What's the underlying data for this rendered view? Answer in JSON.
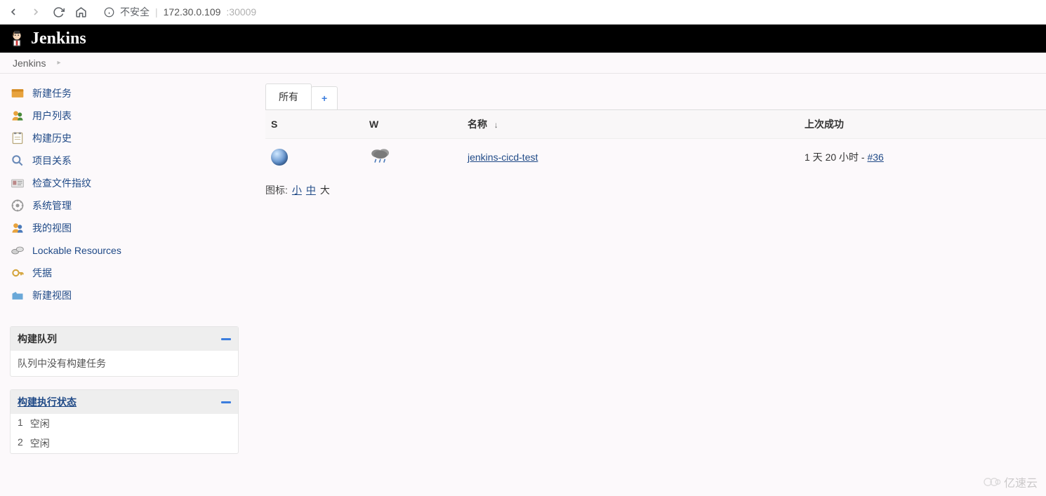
{
  "browser": {
    "insecure_label": "不安全",
    "url_host": "172.30.0.109",
    "url_port": ":30009"
  },
  "header": {
    "app_name": "Jenkins"
  },
  "breadcrumb": {
    "root": "Jenkins"
  },
  "sidebar": {
    "items": [
      {
        "label": "新建任务",
        "icon": "new-item-icon"
      },
      {
        "label": "用户列表",
        "icon": "people-icon"
      },
      {
        "label": "构建历史",
        "icon": "history-icon"
      },
      {
        "label": "项目关系",
        "icon": "relations-icon"
      },
      {
        "label": "检查文件指纹",
        "icon": "fingerprint-icon"
      },
      {
        "label": "系统管理",
        "icon": "manage-icon"
      },
      {
        "label": "我的视图",
        "icon": "my-views-icon"
      },
      {
        "label": "Lockable Resources",
        "icon": "lockable-icon"
      },
      {
        "label": "凭据",
        "icon": "credentials-icon"
      },
      {
        "label": "新建视图",
        "icon": "new-view-icon"
      }
    ]
  },
  "queue": {
    "title": "构建队列",
    "empty_text": "队列中没有构建任务"
  },
  "executors": {
    "title": "构建执行状态",
    "rows": [
      {
        "num": "1",
        "status": "空闲"
      },
      {
        "num": "2",
        "status": "空闲"
      }
    ]
  },
  "tabs": {
    "all": "所有",
    "add": "+"
  },
  "table": {
    "headers": {
      "s": "S",
      "w": "W",
      "name": "名称",
      "sort": "↓",
      "last_success": "上次成功"
    },
    "rows": [
      {
        "name": "jenkins-cicd-test",
        "last_success_time": "1 天 20 小时",
        "sep": " - ",
        "build": "#36"
      }
    ]
  },
  "legend": {
    "label": "图标:",
    "small": "小",
    "medium": "中",
    "large": "大"
  },
  "watermark": "亿速云"
}
